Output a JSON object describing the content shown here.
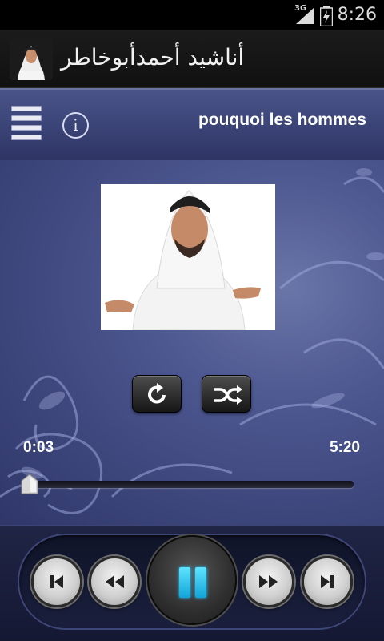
{
  "status_bar": {
    "network": "3G",
    "time": "8:26"
  },
  "app": {
    "title": "أناشيد أحمدأبوخاطر"
  },
  "player": {
    "track_title": "pouquoi les hommes",
    "elapsed": "0:03",
    "total": "5:20",
    "progress": 0.01,
    "state": "playing"
  },
  "icons": {
    "menu": "menu-icon",
    "info": "info-icon",
    "repeat": "repeat-icon",
    "shuffle": "shuffle-icon",
    "previous": "skip-previous-icon",
    "rewind": "rewind-icon",
    "pause": "pause-icon",
    "forward": "fast-forward-icon",
    "next": "skip-next-icon"
  },
  "colors": {
    "accent": "#23c6ff",
    "toolbar": "#3d4679",
    "background": "#3a4377"
  }
}
